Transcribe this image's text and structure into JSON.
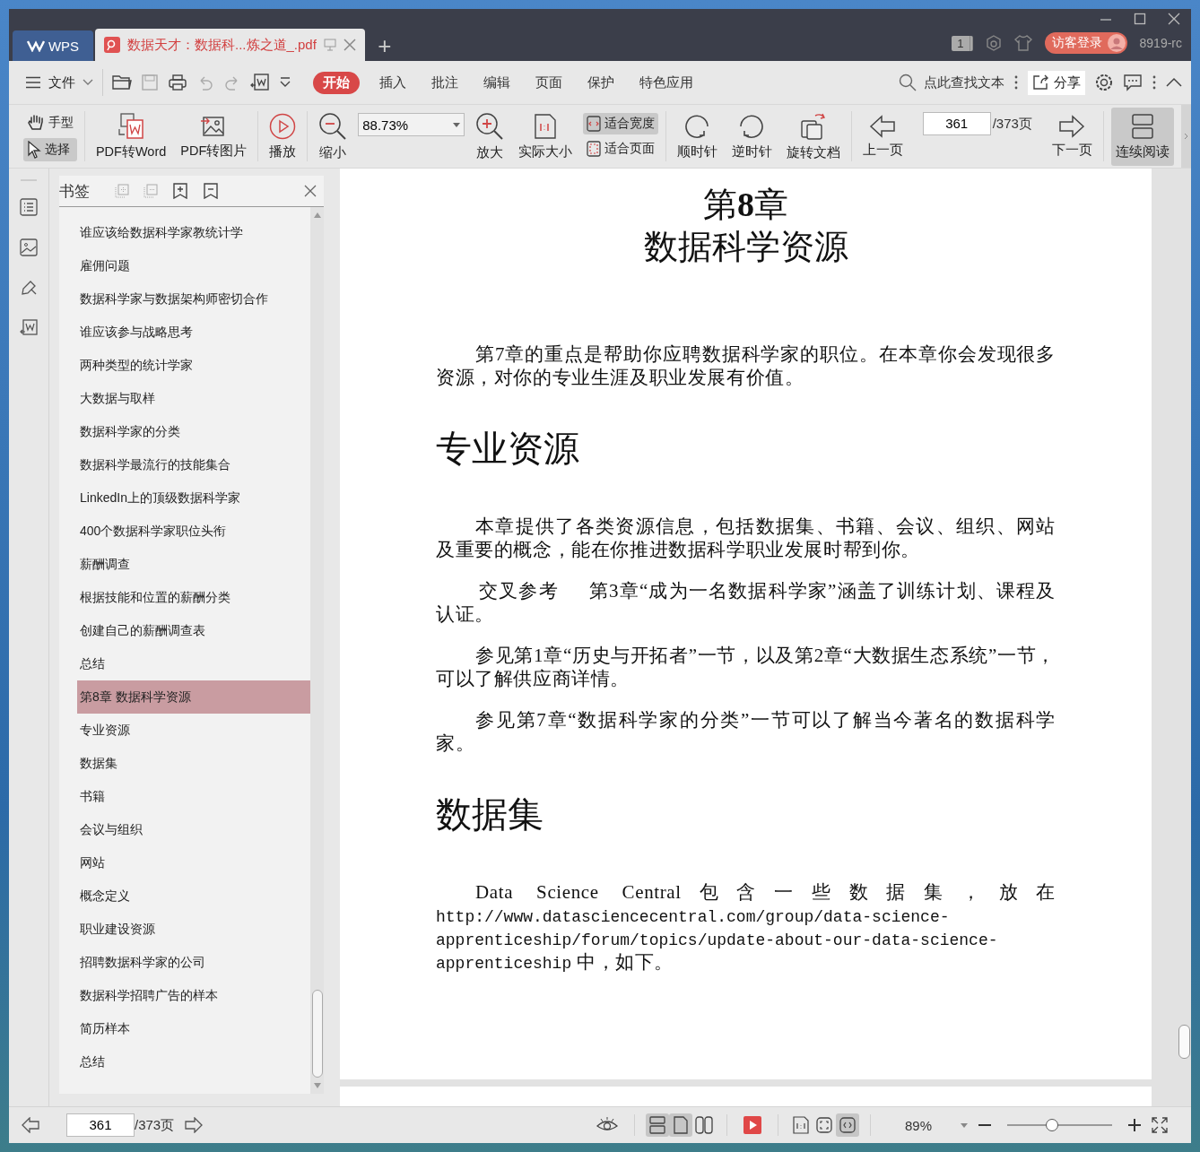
{
  "title_bar": {
    "app_tab": "WPS",
    "doc_tab": {
      "title": "数据天才：数据科...炼之道_.pdf",
      "selected": true
    },
    "new_tab": "+",
    "window_count": "1",
    "login": "访客登录",
    "user": "8919-rc"
  },
  "menu": {
    "file": "文件",
    "tabs": [
      {
        "label": "开始",
        "selected": true
      },
      {
        "label": "插入",
        "selected": false
      },
      {
        "label": "批注",
        "selected": false
      },
      {
        "label": "编辑",
        "selected": false
      },
      {
        "label": "页面",
        "selected": false
      },
      {
        "label": "保护",
        "selected": false
      },
      {
        "label": "特色应用",
        "selected": false
      }
    ],
    "search": "点此查找文本",
    "share": "分享"
  },
  "toolbar": {
    "hand": {
      "label": "手型",
      "selected": false
    },
    "select": {
      "label": "选择",
      "selected": true
    },
    "to_word": "PDF转Word",
    "to_image": "PDF转图片",
    "play": "播放",
    "zoom_out": "缩小",
    "zoom_value": "88.73%",
    "zoom_in": "放大",
    "actual_size": "实际大小",
    "fit_width": {
      "label": "适合宽度",
      "selected": true
    },
    "fit_page": {
      "label": "适合页面",
      "selected": false
    },
    "clockwise": "顺时针",
    "counter_clockwise": "逆时针",
    "rotate_doc": "旋转文档",
    "prev_page": "上一页",
    "page": "361",
    "page_total": "/373页",
    "next_page": "下一页",
    "continuous": {
      "label": "连续阅读",
      "selected": true
    }
  },
  "bookmarks": {
    "title": "书签",
    "items": [
      {
        "label": "谁应该给数据科学家教统计学",
        "selected": false
      },
      {
        "label": "雇佣问题",
        "selected": false
      },
      {
        "label": "数据科学家与数据架构师密切合作",
        "selected": false
      },
      {
        "label": "谁应该参与战略思考",
        "selected": false
      },
      {
        "label": "两种类型的统计学家",
        "selected": false
      },
      {
        "label": "大数据与取样",
        "selected": false
      },
      {
        "label": "数据科学家的分类",
        "selected": false
      },
      {
        "label": "数据科学最流行的技能集合",
        "selected": false
      },
      {
        "label": "LinkedIn上的顶级数据科学家",
        "selected": false
      },
      {
        "label": "400个数据科学家职位头衔",
        "selected": false
      },
      {
        "label": "薪酬调查",
        "selected": false
      },
      {
        "label": "根据技能和位置的薪酬分类",
        "selected": false
      },
      {
        "label": "创建自己的薪酬调查表",
        "selected": false
      },
      {
        "label": "总结",
        "selected": false
      },
      {
        "label": "第8章 数据科学资源",
        "selected": true
      },
      {
        "label": "专业资源",
        "selected": false
      },
      {
        "label": "数据集",
        "selected": false
      },
      {
        "label": "书籍",
        "selected": false
      },
      {
        "label": "会议与组织",
        "selected": false
      },
      {
        "label": "网站",
        "selected": false
      },
      {
        "label": "概念定义",
        "selected": false
      },
      {
        "label": "职业建设资源",
        "selected": false
      },
      {
        "label": "招聘数据科学家的公司",
        "selected": false
      },
      {
        "label": "数据科学招聘广告的样本",
        "selected": false
      },
      {
        "label": "简历样本",
        "selected": false
      },
      {
        "label": "总结",
        "selected": false
      }
    ]
  },
  "document": {
    "blocks": [
      {
        "kind": "chapter",
        "number": "第**8**章",
        "title": "数据科学资源"
      },
      {
        "kind": "paragraph",
        "text": "第7章的重点是帮助你应聘数据科学家的职位。在本章你会发现很多资源，对你的专业生涯及职业发展有价值。"
      },
      {
        "kind": "heading",
        "text": "专业资源"
      },
      {
        "kind": "paragraph",
        "text": "本章提供了各类资源信息，包括数据集、书籍、会议、组织、网站及重要的概念，能在你推进数据科学职业发展时帮到你。"
      },
      {
        "kind": "cross_ref",
        "label": "交叉参考",
        "text": "第3章“成为一名数据科学家”涵盖了训练计划、课程及认证。"
      },
      {
        "kind": "paragraph",
        "text": "参见第1章“历史与开拓者”一节，以及第2章“大数据生态系统”一节，可以了解供应商详情。"
      },
      {
        "kind": "paragraph",
        "text": "参见第7章“数据科学家的分类”一节可以了解当今著名的数据科学家。"
      },
      {
        "kind": "heading",
        "text": "数据集"
      },
      {
        "kind": "url_paragraph",
        "before": "Data Science Central包含一些数据集，放在",
        "url": "http://www.datasciencecentral.com/group/data-science-apprenticeship/forum/topics/update-about-our-data-science-apprenticeship",
        "after": " 中，如下。"
      }
    ]
  },
  "status_bar": {
    "page": "361",
    "page_total": "/373页",
    "views": [
      {
        "kind": "continuous",
        "selected": true
      },
      {
        "kind": "single",
        "selected": true
      },
      {
        "kind": "double",
        "selected": false
      }
    ],
    "fits": [
      {
        "kind": "actual",
        "selected": false
      },
      {
        "kind": "page",
        "selected": false
      },
      {
        "kind": "width",
        "selected": true
      }
    ],
    "zoom": "89%",
    "zoom_slider": {
      "level": 0.43
    }
  }
}
